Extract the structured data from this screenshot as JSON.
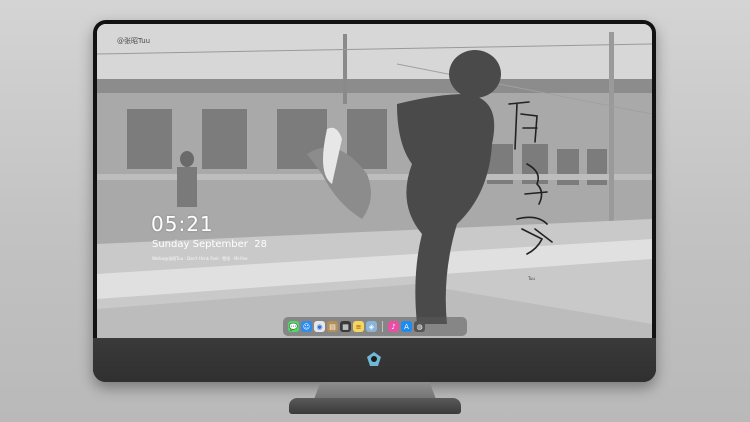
{
  "desktop": {
    "watermark": "@张昭Tuu",
    "clock": "05:21",
    "date": "Sunday September  28",
    "subtitle": "Weibo@张昭Tuu · Don't think  Feel · 壁纸 · Mi-fine",
    "photo_tag": "Tuu"
  },
  "dock": {
    "items": [
      {
        "name": "messages-icon",
        "color": "#4cd964",
        "glyph": "💬"
      },
      {
        "name": "finder-icon",
        "color": "#2f8cf0",
        "glyph": "☺"
      },
      {
        "name": "safari-icon",
        "color": "#e8e8e8",
        "glyph": "◉"
      },
      {
        "name": "preview-icon",
        "color": "#b58f57",
        "glyph": "▤"
      },
      {
        "name": "claquette-icon",
        "color": "#3a3a3a",
        "glyph": "▦"
      },
      {
        "name": "notes-icon",
        "color": "#f7d560",
        "glyph": "≡"
      },
      {
        "name": "photos-icon",
        "color": "#8ab4d8",
        "glyph": "◈"
      }
    ],
    "items_right": [
      {
        "name": "itunes-icon",
        "color": "#e84fa5",
        "glyph": "♪"
      },
      {
        "name": "app-store-icon",
        "color": "#1f8af0",
        "glyph": "A"
      },
      {
        "name": "camera-icon",
        "color": "#555555",
        "glyph": "◍"
      }
    ]
  },
  "colors": {
    "bezel": "#121212",
    "chin": "#333333"
  }
}
